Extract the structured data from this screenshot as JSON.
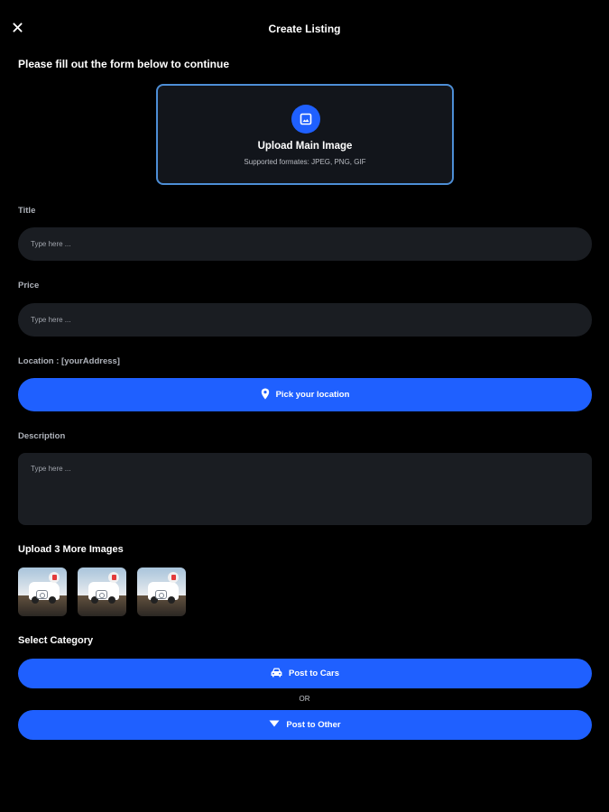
{
  "header": {
    "title": "Create Listing",
    "close_icon": "close-icon"
  },
  "form": {
    "instructions": "Please fill out the form below to continue",
    "main_image": {
      "title": "Upload Main Image",
      "subtitle": "Supported formates: JPEG, PNG, GIF",
      "icon": "image-icon"
    },
    "title_field": {
      "label": "Title",
      "placeholder": "Type here ..."
    },
    "price_field": {
      "label": "Price",
      "placeholder": "Type here ..."
    },
    "location": {
      "label": "Location : [yourAddress]",
      "button_label": "Pick your location",
      "icon": "location-pin-icon"
    },
    "description_field": {
      "label": "Description",
      "placeholder": "Type here ..."
    },
    "more_images": {
      "label": "Upload 3 More Images",
      "count": 3,
      "delete_icon": "delete-icon"
    },
    "category": {
      "label": "Select Category",
      "cars_button": "Post to Cars",
      "cars_icon": "car-icon",
      "separator": "OR",
      "other_button": "Post to Other",
      "other_icon": "dropdown-triangle-icon"
    }
  },
  "colors": {
    "background": "#000000",
    "accent": "#1f60ff",
    "field_background": "#1a1d22",
    "upload_border": "#4d8ed6",
    "delete_badge": "#e33a3a"
  }
}
